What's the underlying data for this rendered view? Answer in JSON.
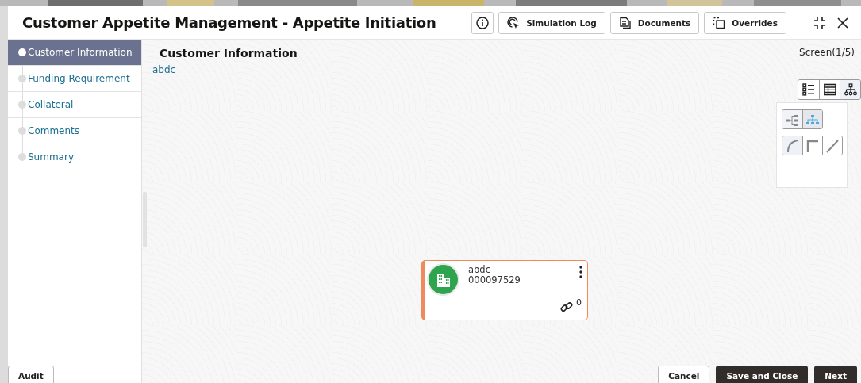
{
  "window": {
    "title": "Customer Appetite Management - Appetite Initiation"
  },
  "header_buttons": [
    {
      "kind": "info"
    },
    {
      "kind": "simulation",
      "label": "Simulation Log"
    },
    {
      "kind": "documents",
      "label": "Documents"
    },
    {
      "kind": "overrides",
      "label": "Overrides"
    }
  ],
  "sidebar": {
    "items": [
      {
        "label": "Customer Information",
        "selected": true
      },
      {
        "label": "Funding Requirement",
        "selected": false
      },
      {
        "label": "Collateral",
        "selected": false
      },
      {
        "label": "Comments",
        "selected": false
      },
      {
        "label": "Summary",
        "selected": false
      }
    ]
  },
  "content": {
    "title": "Customer Information",
    "subtitle": "abdc",
    "screen": "Screen(1/5)"
  },
  "view_toggle": [
    {
      "kind": "list",
      "selected": false
    },
    {
      "kind": "table",
      "selected": false
    },
    {
      "kind": "tree",
      "selected": true
    }
  ],
  "layout_toggle": [
    {
      "kind": "horizontal",
      "selected": false
    },
    {
      "kind": "vertical",
      "selected": true
    }
  ],
  "link_style": [
    {
      "kind": "curved",
      "selected": true
    },
    {
      "kind": "elbow",
      "selected": false
    },
    {
      "kind": "straight",
      "selected": false
    }
  ],
  "node": {
    "name": "abdc",
    "id": "000097529",
    "links": "0"
  },
  "footer": {
    "left": [
      {
        "label": "Audit",
        "kind": "secondary"
      }
    ],
    "right": [
      {
        "label": "Cancel",
        "kind": "secondary"
      },
      {
        "label": "Save and Close",
        "kind": "primary"
      },
      {
        "label": "Next",
        "kind": "primary"
      }
    ]
  }
}
